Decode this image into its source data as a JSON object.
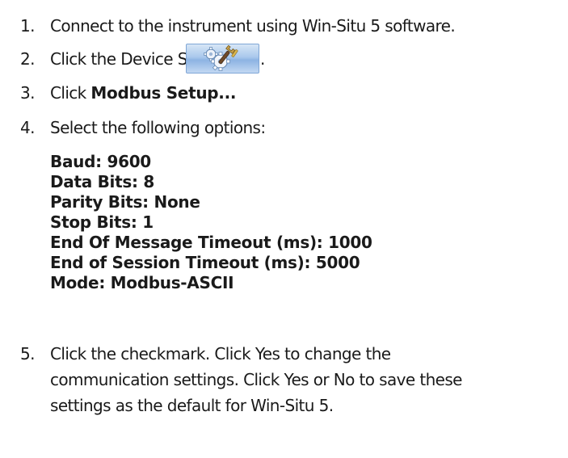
{
  "steps": [
    {
      "number": "1.",
      "text": "Connect to the instrument using Win-Situ 5 software."
    },
    {
      "number": "2.",
      "text": "Click the Device Setup tab",
      "suffix": "."
    },
    {
      "number": "3.",
      "prefix": "Click ",
      "bold": "Modbus Setup..."
    },
    {
      "number": "4.",
      "text": "Select the following options:"
    },
    {
      "number": "5.",
      "lines": [
        "Click the checkmark. Click Yes to change the",
        "communication settings. Click Yes or No to save these",
        "settings as the default for Win-Situ 5."
      ]
    }
  ],
  "settings": [
    "Baud: 9600",
    "Data Bits: 8",
    "Parity Bits: None",
    "Stop Bits: 1",
    "End Of Message Timeout (ms): 1000",
    "End of Session Timeout (ms): 5000",
    "Mode: Modbus-ASCII"
  ],
  "device_setup_tab": {
    "icon": "gear-wrench-icon",
    "accent": "#9dbde8"
  }
}
